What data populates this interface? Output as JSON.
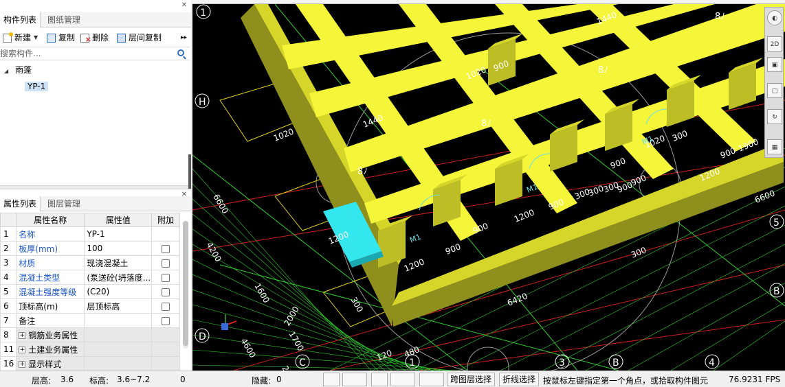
{
  "component_panel": {
    "tab_active": "构件列表",
    "tab_other": "图纸管理",
    "toolbar": {
      "new_label": "新建",
      "copy_label": "复制",
      "delete_label": "删除",
      "floor_copy_label": "层间复制",
      "more": "▸▸"
    },
    "search_placeholder": "搜索构件...",
    "tree": {
      "parent": "雨蓬",
      "child": "YP-1"
    }
  },
  "property_panel": {
    "tab_active": "属性列表",
    "tab_other": "图层管理",
    "headers": [
      "属性名称",
      "属性值",
      "附加"
    ],
    "rows": [
      {
        "num": "1",
        "name": "名称",
        "value": "YP-1",
        "blue": true,
        "check": false,
        "group": false
      },
      {
        "num": "2",
        "name": "板厚(mm)",
        "value": "100",
        "blue": true,
        "check": true,
        "group": false
      },
      {
        "num": "3",
        "name": "材质",
        "value": "现浇混凝土",
        "blue": true,
        "check": true,
        "group": false
      },
      {
        "num": "4",
        "name": "混凝土类型",
        "value": "(泵送砼(坍落度...",
        "blue": true,
        "check": true,
        "group": false
      },
      {
        "num": "5",
        "name": "混凝土强度等级",
        "value": "(C20)",
        "blue": true,
        "check": true,
        "group": false
      },
      {
        "num": "6",
        "name": "顶标高(m)",
        "value": "层顶标高",
        "blue": false,
        "check": true,
        "group": false
      },
      {
        "num": "7",
        "name": "备注",
        "value": "",
        "blue": false,
        "check": true,
        "group": false
      },
      {
        "num": "8",
        "name": "钢筋业务属性",
        "value": "",
        "blue": false,
        "check": false,
        "group": true
      },
      {
        "num": "11",
        "name": "土建业务属性",
        "value": "",
        "blue": false,
        "check": false,
        "group": true
      },
      {
        "num": "16",
        "name": "显示样式",
        "value": "",
        "blue": false,
        "check": false,
        "group": true
      }
    ]
  },
  "viewport": {
    "axis_labels": [
      "1",
      "H",
      "D",
      "C",
      "1",
      "3",
      "B",
      "4",
      "5",
      "B"
    ],
    "dimensions": [
      "1440",
      "1020",
      "900",
      "1020",
      "1440",
      "1020",
      "900",
      "900",
      "1200",
      "900",
      "300",
      "900",
      "1200",
      "900",
      "300",
      "900",
      "1200",
      "900",
      "1900",
      "300",
      "900",
      "300",
      "300",
      "6600",
      "6600",
      "6420",
      "4200",
      "1600",
      "2000",
      "1200",
      "300",
      "4600",
      "120",
      "480",
      "2000",
      "1700"
    ],
    "room_labels": [
      "8ﾉ",
      "8ﾉ",
      "8ﾉ",
      "8ﾉ"
    ],
    "door_labels": [
      "M1",
      "M1",
      "M1"
    ],
    "colors": {
      "background": "#000000",
      "wall": "#d5d52a",
      "wall_side": "#8f8f1e",
      "beam": "#f5f53a",
      "selected": "#34e6ee",
      "axis": "#ffffff",
      "dim": "#2fd02f",
      "grid_red": "#d01f1f"
    }
  },
  "nav_tools": {
    "btn_2d": "2D"
  },
  "status_bar": {
    "floor_height_label": "层高:",
    "floor_height_value": "3.6",
    "elevation_label": "标高:",
    "elevation_value": "3.6~7.2",
    "count": "0",
    "hidden_label": "隐藏:",
    "hidden_value": "0",
    "cross_layer": "跨图层选择",
    "polyline_select": "折线选择",
    "hint": "按鼠标左键指定第一个角点，或拾取构件图元",
    "fps": "76.9231 FPS"
  }
}
